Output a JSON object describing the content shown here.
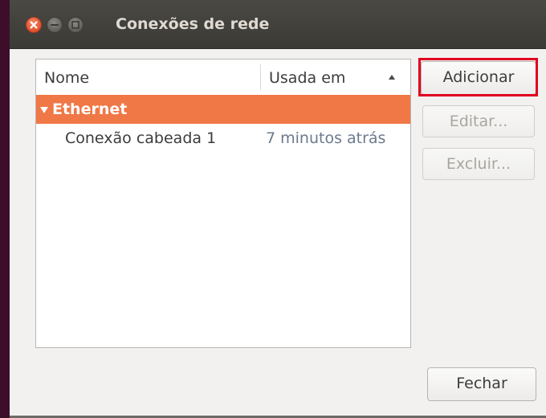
{
  "window": {
    "title": "Conexões de rede",
    "controls": [
      "close-icon",
      "minimize-icon",
      "maximize-icon"
    ]
  },
  "list": {
    "columns": {
      "name": "Nome",
      "used": "Usada em",
      "sort_indicator": "ascending"
    },
    "groups": [
      {
        "label": "Ethernet",
        "expanded": true,
        "items": [
          {
            "name": "Conexão cabeada 1",
            "used": "7 minutos atrás"
          }
        ]
      }
    ]
  },
  "actions": {
    "add_label": "Adicionar",
    "edit_label": "Editar...",
    "delete_label": "Excluir...",
    "close_label": "Fechar"
  },
  "colors": {
    "selected_group_bg": "#f07746",
    "highlight_outline": "#e00020",
    "titlebar_bg": "#3b3a36",
    "close_button": "#e0502b"
  }
}
